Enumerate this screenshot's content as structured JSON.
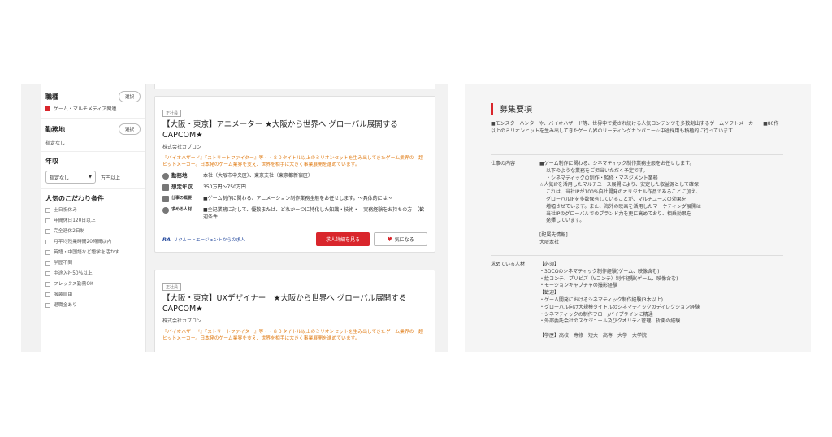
{
  "sidebar": {
    "job_type": {
      "title": "職種",
      "select_label": "選択",
      "checked_item": "ゲーム・マルチメディア関連"
    },
    "location": {
      "title": "勤務地",
      "select_label": "選択",
      "value": "指定なし"
    },
    "income": {
      "title": "年収",
      "select_value": "指定なし",
      "unit": "万円以上"
    },
    "preferences": {
      "title": "人気のこだわり条件",
      "items": [
        "土日祝休み",
        "年間休日120日以上",
        "完全週休2日制",
        "月平均残業時間20時間以内",
        "英語・中国語など語学を活かす",
        "学歴不問",
        "中途入社50%以上",
        "フレックス勤務OK",
        "服装自由",
        "退職金あり"
      ]
    }
  },
  "jobs": [
    {
      "badge": "正社員",
      "title": "【大阪・東京】アニメーター ★大阪から世界へ グローバル展開するCAPCOM★",
      "company": "株式会社カプコン",
      "highlight": "『バイオハザード』『ストリートファイター』等・・８０タイトル以上のミリオンセットを生み出してきたゲーム業界の　超ヒットメーカー。日本発のゲーム業界を支え、世界を相手に大きく事業展開を進めています。",
      "location_label": "勤務地",
      "location": "本社（大阪市中央区）、東京支社（東京都新宿区）",
      "salary_label": "想定年収",
      "salary": "350万円～750万円",
      "duty_label": "仕事の概要",
      "duty": "■ゲーム制作に関わる、アニメーション制作業務全般をお任せします。～具体的には～",
      "req_label": "求める人材",
      "req": "■全記業務に対して、優数または、どれかーつに特化した知識・技術・　実務経験をお持ちの方　【歓迎条件…",
      "agent": "リクルートエージェントからの求人",
      "agent_logo": "RA",
      "detail_button": "求人詳細を見る",
      "fav_button": "気になる"
    },
    {
      "badge": "正社員",
      "title": "【大阪・東京】UXデザイナー　★大阪から世界へ グローバル展開するCAPCOM★",
      "company": "株式会社カプコン",
      "highlight": "『バイオハザード』『ストリートファイター』等・・８０タイトル以上のミリオンセットを生み出してきたゲーム業界の　超ヒットメーカー。日本発のゲーム業界を支え、世界を相手に大きく事業展開を進めています。"
    }
  ],
  "requirements": {
    "title": "募集要項",
    "intro": "■モンスターハンターや、バイオハザード等、世界中で愛され続ける人気コンテンツを多数創出するゲームソフトメーカー　■80作以上のミリオンヒットを生み出してきたゲーム界のリーディングカンパニー☆中途採用も積極的に行っています",
    "duty_label": "仕事の内容",
    "duty_lines": [
      "■ゲーム制作に関わる、シネマティック制作業務全般をお任せします。",
      "以下のような業務をご担当いただく予定です。",
      "・シネマティックの制作・監修・マネジメント業務",
      "☆人気IPを活用したマルチユース展開により、安定した収益源として確保",
      "これは、当社IPが100%自社開発のオリジナル作品であることに加え、",
      "グローバルIPを多数保有していることが、マルチユースの効果を",
      "増幅させています。また、海外の映画を活用したマーケティング展開は",
      "当社IPのグローバルでのブランド力を更に高めており、相乗効果を",
      "発揮しています。",
      "",
      "[配属先情報]",
      "大阪本社"
    ],
    "talent_label": "求めている人材",
    "talent_lines": [
      "【必須】",
      "・3DCGのシネマティック制作経験(ゲーム、映像含む)",
      "・絵コンテ、プリビズ（Vコンテ）制作経験(ゲーム、映像含む)",
      "・モーションキャプチャの撮影経験",
      "【歓迎】",
      "・ゲーム開発におけるシネマティック制作経験(3本以上)",
      "・グローバル向け大規模タイトルのシネマティックのディレクション経験",
      "・シネマティックの制作フロー/パイプラインに精通",
      "・外部委託会社のスケジュール及びクオリティ管理、折衝の経験",
      "",
      "【学歴】高校　専修　短大　高専　大学　大学院"
    ]
  }
}
